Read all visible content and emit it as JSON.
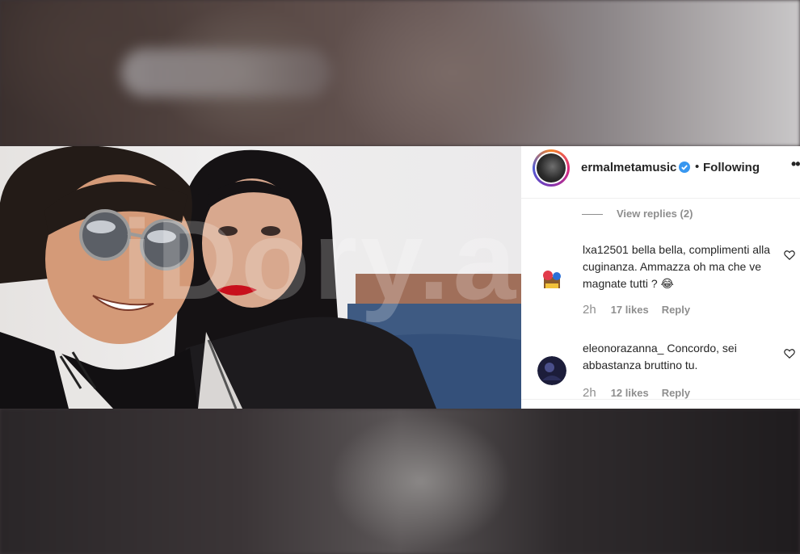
{
  "watermark": "iDory.al",
  "post": {
    "username": "ermalmetamusic",
    "separator": "•",
    "following_label": "Following",
    "more_label": "••",
    "view_replies": "View replies (2)"
  },
  "comments": [
    {
      "user": "lxa12501",
      "text": "bella bella, complimenti alla cuginanza. Ammazza oh ma che ve magnate tutti ? 😂",
      "time": "2h",
      "likes": "17 likes",
      "reply": "Reply"
    },
    {
      "user": "eleonorazanna_",
      "text": "Concordo, sei abbastanza bruttino tu.",
      "time": "2h",
      "likes": "12 likes",
      "reply": "Reply"
    }
  ],
  "colors": {
    "verified": "#3897f0",
    "text": "#262626",
    "muted": "#8e8e8e"
  }
}
